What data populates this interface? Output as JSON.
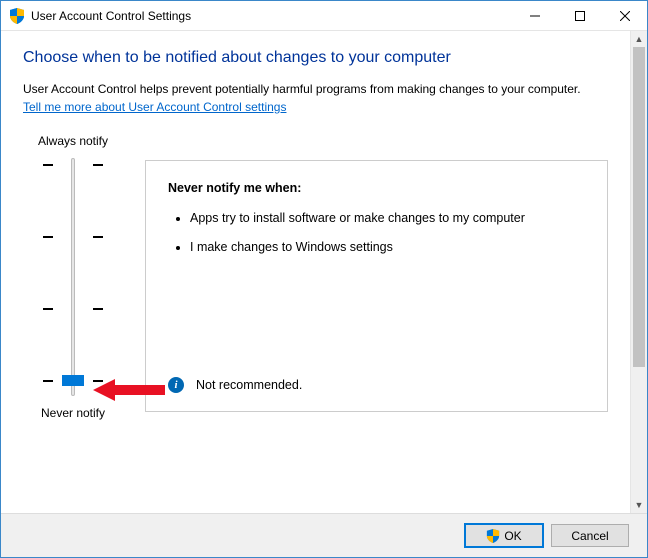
{
  "window": {
    "title": "User Account Control Settings"
  },
  "heading": "Choose when to be notified about changes to your computer",
  "description": "User Account Control helps prevent potentially harmful programs from making changes to your computer.",
  "help_link": "Tell me more about User Account Control settings",
  "slider": {
    "top_label": "Always notify",
    "bottom_label": "Never notify"
  },
  "panel": {
    "title": "Never notify me when:",
    "items": [
      "Apps try to install software or make changes to my computer",
      "I make changes to Windows settings"
    ],
    "status": "Not recommended."
  },
  "footer": {
    "ok": "OK",
    "cancel": "Cancel"
  }
}
